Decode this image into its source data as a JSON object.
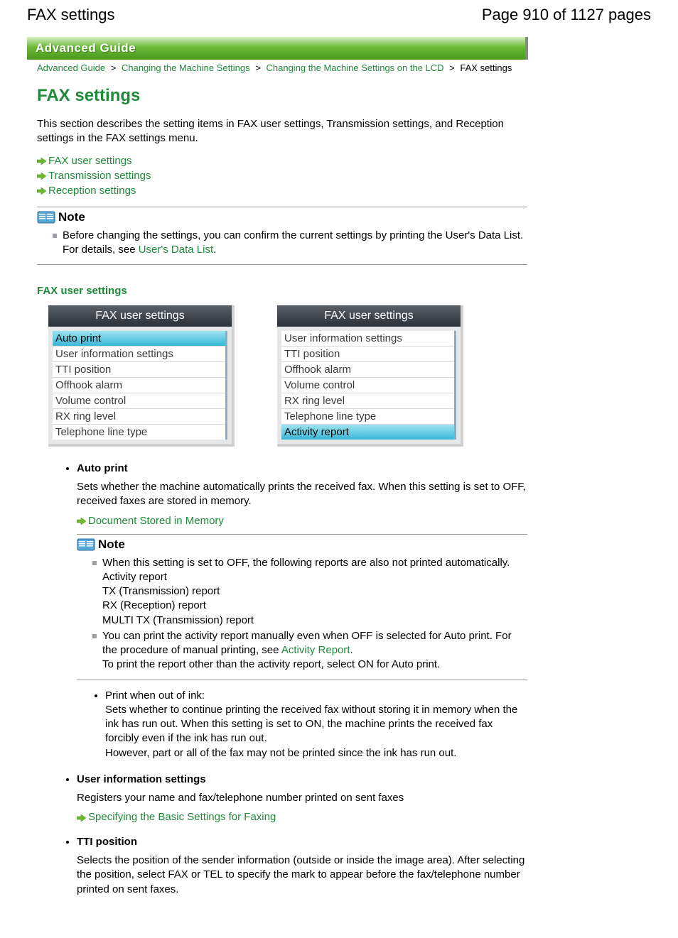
{
  "header": {
    "title": "FAX settings",
    "page_info": "Page 910 of 1127 pages"
  },
  "banner": "Advanced Guide",
  "breadcrumb": {
    "items": [
      "Advanced Guide",
      "Changing the Machine Settings",
      "Changing the Machine Settings on the LCD"
    ],
    "current": "FAX settings",
    "sep": ">"
  },
  "h1": "FAX settings",
  "intro": "This section describes the setting items in FAX user settings, Transmission settings, and Reception settings in the FAX settings menu.",
  "quick_links": [
    "FAX user settings",
    "Transmission settings",
    "Reception settings"
  ],
  "note1": {
    "title": "Note",
    "text_before": "Before changing the settings, you can confirm the current settings by printing the User's Data List. For details, see ",
    "link": "User's Data List",
    "text_after": "."
  },
  "section_title": "FAX user settings",
  "lcd": {
    "title": "FAX user settings",
    "left_items": [
      "Auto print",
      "User information settings",
      "TTI position",
      "Offhook alarm",
      "Volume control",
      "RX ring level",
      "Telephone line type"
    ],
    "left_selected": 0,
    "right_items": [
      "User information settings",
      "TTI position",
      "Offhook alarm",
      "Volume control",
      "RX ring level",
      "Telephone line type",
      "Activity report"
    ],
    "right_selected": 6
  },
  "items": {
    "auto_print": {
      "title": "Auto print",
      "desc": "Sets whether the machine automatically prints the received fax. When this setting is set to OFF, received faxes are stored in memory.",
      "link": "Document Stored in Memory",
      "note": {
        "title": "Note",
        "b1": "When this setting is set to OFF, the following reports are also not printed automatically.",
        "reports": [
          "Activity report",
          "TX (Transmission) report",
          "RX (Reception) report",
          "MULTI TX (Transmission) report"
        ],
        "b2_before": "You can print the activity report manually even when OFF is selected for Auto print. For the procedure of manual printing, see ",
        "b2_link": "Activity Report",
        "b2_after": ".",
        "b2_extra": "To print the report other than the activity report, select ON for Auto print."
      },
      "sub": {
        "title": "Print when out of ink:",
        "desc": "Sets whether to continue printing the received fax without storing it in memory when the ink has run out. When this setting is set to ON, the machine prints the received fax forcibly even if the ink has run out.",
        "extra": "However, part or all of the fax may not be printed since the ink has run out."
      }
    },
    "user_info": {
      "title": "User information settings",
      "desc": "Registers your name and fax/telephone number printed on sent faxes",
      "link": "Specifying the Basic Settings for Faxing"
    },
    "tti": {
      "title": "TTI position",
      "desc": "Selects the position of the sender information (outside or inside the image area). After selecting the position, select FAX or TEL to specify the mark to appear before the fax/telephone number printed on sent faxes."
    }
  }
}
